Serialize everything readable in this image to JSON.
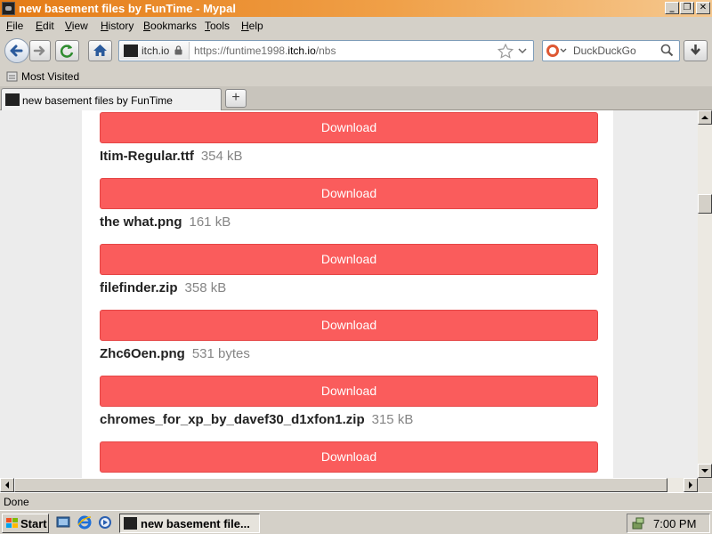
{
  "window": {
    "title": "new basement files by FunTime - Mypal",
    "controls": [
      "minimize",
      "restore",
      "close"
    ]
  },
  "menu": [
    {
      "label": "File",
      "underline": "F",
      "rest": "ile"
    },
    {
      "label": "Edit",
      "underline": "E",
      "rest": "dit"
    },
    {
      "label": "View",
      "underline": "V",
      "rest": "iew"
    },
    {
      "label": "History",
      "underline": "H",
      "rest": "istory"
    },
    {
      "label": "Bookmarks",
      "underline": "B",
      "rest": "ookmarks"
    },
    {
      "label": "Tools",
      "underline": "T",
      "rest": "ools"
    },
    {
      "label": "Help",
      "underline": "H",
      "rest": "elp"
    }
  ],
  "navbar": {
    "site_identity": "itch.io",
    "url_prefix": "https://funtime1998.",
    "url_domain": "itch.io",
    "url_suffix": "/nbs",
    "search_placeholder": "DuckDuckGo"
  },
  "bookmarks": {
    "most_visited": "Most Visited"
  },
  "tabs": [
    {
      "label": "new basement files by FunTime",
      "active": true
    }
  ],
  "newtab_label": "+",
  "content": {
    "download_label": "Download",
    "files": [
      {
        "name": "Itim-Regular.ttf",
        "size": "354 kB"
      },
      {
        "name": "the what.png",
        "size": "161 kB"
      },
      {
        "name": "filefinder.zip",
        "size": "358 kB"
      },
      {
        "name": "Zhc6Oen.png",
        "size": "531 bytes"
      },
      {
        "name": "chromes_for_xp_by_davef30_d1xfon1.zip",
        "size": "315 kB"
      }
    ]
  },
  "status": {
    "text": "Done"
  },
  "taskbar": {
    "start_label": "Start",
    "task_label": "new basement file...",
    "clock": "7:00 PM"
  },
  "colors": {
    "download_button": "#fa5c5c",
    "titlebar_start": "#e47b16",
    "titlebar_end": "#f5c88f"
  }
}
